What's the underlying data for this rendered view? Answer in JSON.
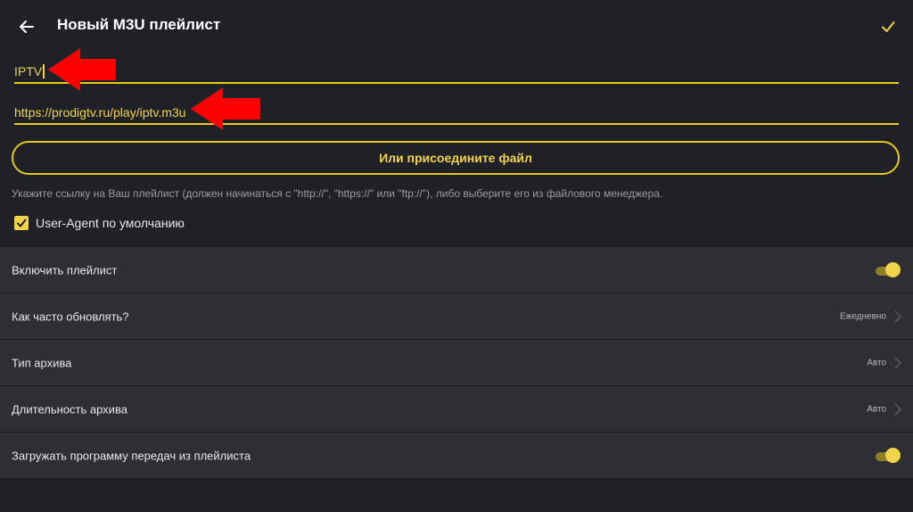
{
  "header": {
    "title": "Новый M3U плейлист",
    "back_icon": "arrow-left-icon",
    "confirm_icon": "check-icon"
  },
  "form": {
    "name_value": "IPTV",
    "url_value": "https://prodigtv.ru/play/iptv.m3u",
    "attach_label": "Или присоедините файл",
    "hint": "Укажите ссылку на Ваш плейлист (должен начинаться с \"http://\", \"https://\" или \"ftp://\"), либо выберите его из файлового менеджера.",
    "user_agent_label": "User-Agent по умолчанию",
    "user_agent_checked": true
  },
  "settings": {
    "items": [
      {
        "label": "Включить плейлист",
        "type": "toggle",
        "on": true
      },
      {
        "label": "Как часто обновлять?",
        "type": "select",
        "value": "Ежедневно"
      },
      {
        "label": "Тип архива",
        "type": "select",
        "value": "Авто"
      },
      {
        "label": "Длительность архива",
        "type": "select",
        "value": "Авто"
      },
      {
        "label": "Загружать программу передач из плейлиста",
        "type": "toggle",
        "on": true
      }
    ]
  },
  "colors": {
    "accent": "#f2d44b",
    "background": "#1f2126",
    "row_background": "#2d2f35",
    "annotation_arrow": "#ff0000"
  }
}
